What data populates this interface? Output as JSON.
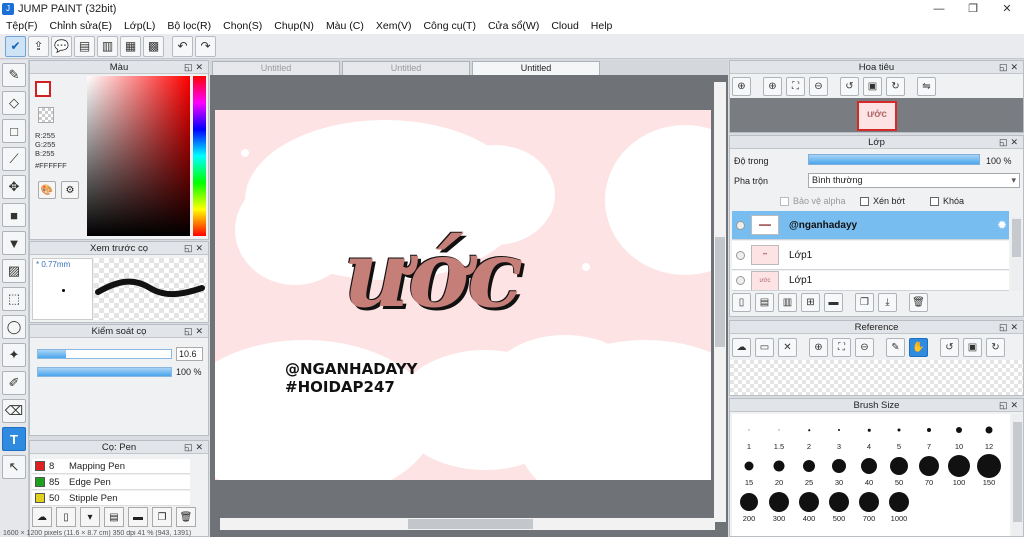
{
  "window": {
    "title": "JUMP PAINT (32bit)"
  },
  "menu": [
    "Tệp(F)",
    "Chỉnh sửa(E)",
    "Lớp(L)",
    "Bộ lọc(R)",
    "Chọn(S)",
    "Chụp(N)",
    "Màu (C)",
    "Xem(V)",
    "Công cụ(T)",
    "Cửa sổ(W)",
    "Cloud",
    "Help"
  ],
  "colors": {
    "accent": "#2f8be0",
    "canvas_bg": "#fde3e3",
    "selected_layer": "#78bdf0"
  },
  "color_panel": {
    "title": "Màu",
    "r": "R:255",
    "g": "G:255",
    "b": "B:255",
    "hex": "#FFFFFF"
  },
  "preview_panel": {
    "title": "Xem trước cọ",
    "size": "* 0.77mm"
  },
  "brush_control": {
    "title": "Kiểm soát cọ",
    "size_value": "10.6",
    "size_fill": 0.21,
    "opacity_value": "100 %",
    "opacity_fill": 1.0
  },
  "pen_panel": {
    "title": "Cọ: Pen",
    "items": [
      {
        "num": "8",
        "name": "Mapping Pen",
        "color": "#e02020"
      },
      {
        "num": "85",
        "name": "Edge Pen",
        "color": "#20a020"
      },
      {
        "num": "50",
        "name": "Stipple Pen",
        "color": "#e0d020"
      }
    ]
  },
  "tabs": [
    {
      "label": "Untitled",
      "active": false
    },
    {
      "label": "Untitled",
      "active": false
    },
    {
      "label": "Untitled",
      "active": true
    }
  ],
  "artwork": {
    "title": "ước",
    "line1": "@NGANHADAYY",
    "line2": "#HOIDAP247"
  },
  "nav_panel": {
    "title": "Hoa tiêu",
    "thumb_text": "ước"
  },
  "layer_panel": {
    "title": "Lớp",
    "opacity_label": "Độ trong",
    "opacity_value": "100 %",
    "opacity_fill": 1.0,
    "blend_label": "Pha trộn",
    "blend_value": "Bình thường",
    "protect_alpha": "Bảo vệ alpha",
    "clipping": "Xén bớt",
    "lock": "Khóa",
    "layers": [
      {
        "name": "@nganhadayy",
        "selected": true
      },
      {
        "name": "Lớp1",
        "selected": false
      },
      {
        "name": "Lớp1",
        "selected": false
      }
    ]
  },
  "ref_panel": {
    "title": "Reference"
  },
  "brush_size": {
    "title": "Brush Size",
    "sizes": [
      "1",
      "1.5",
      "2",
      "3",
      "4",
      "5",
      "7",
      "10",
      "12",
      "15",
      "20",
      "25",
      "30",
      "40",
      "50",
      "70",
      "100",
      "150",
      "200",
      "300",
      "400",
      "500",
      "700",
      "1000"
    ]
  },
  "statusbar": "1600 × 1200 pixels (11.6 × 8.7 cm) 350 dpi 41 % (943, 1391)"
}
